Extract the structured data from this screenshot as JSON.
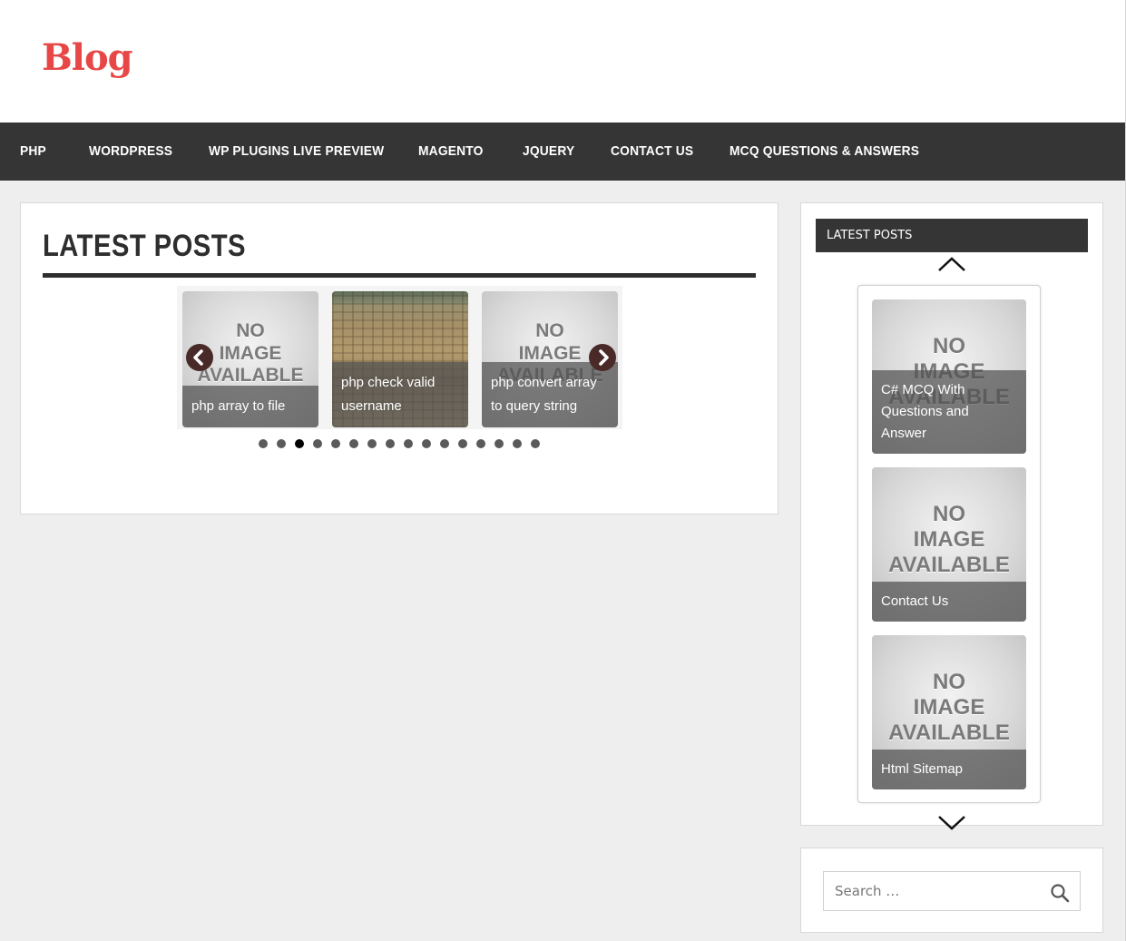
{
  "header": {
    "site_title": "Blog"
  },
  "nav": {
    "items": [
      {
        "label": "PHP"
      },
      {
        "label": "WORDPRESS"
      },
      {
        "label": "WP PLUGINS LIVE PREVIEW"
      },
      {
        "label": "MAGENTO"
      },
      {
        "label": "JQUERY"
      },
      {
        "label": "CONTACT US"
      },
      {
        "label": "MCQ QUESTIONS & ANSWERS"
      }
    ]
  },
  "main": {
    "section_title": "LATEST POSTS",
    "no_image_text": [
      "NO",
      "IMAGE",
      "AVAILABLE"
    ],
    "slides": [
      {
        "caption": "php array to file",
        "image": "no-image"
      },
      {
        "caption": "php check valid username",
        "image": "photo"
      },
      {
        "caption": "php convert array to query string",
        "image": "no-image"
      }
    ],
    "prev_icon": "chevron-left-icon",
    "next_icon": "chevron-right-icon",
    "dot_count": 16,
    "active_dot": 3
  },
  "sidebar": {
    "widget_title": "LATEST POSTS",
    "up_icon": "chevron-up-icon",
    "down_icon": "chevron-down-icon",
    "items": [
      {
        "caption": "C# MCQ With Questions and Answer"
      },
      {
        "caption": "Contact Us"
      },
      {
        "caption": "Html Sitemap"
      }
    ]
  },
  "search": {
    "placeholder": "Search …",
    "icon": "search-icon"
  }
}
